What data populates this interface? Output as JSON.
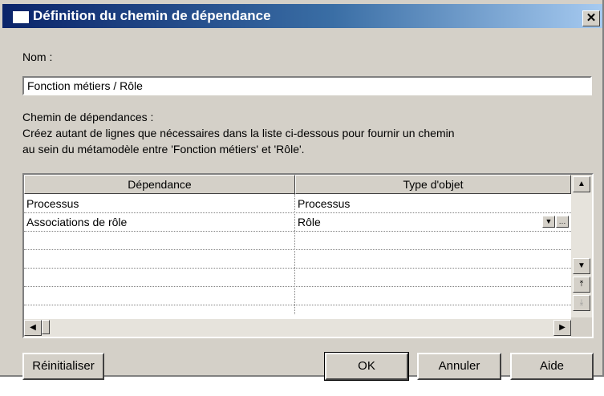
{
  "window": {
    "title": "Définition du chemin de dépendance",
    "close_glyph": "✕"
  },
  "form": {
    "nom_label": "Nom :",
    "nom_value": "Fonction métiers / Rôle",
    "chemin_label": "Chemin de dépendances :",
    "description_line1": "Créez autant de lignes que nécessaires dans la liste ci-dessous pour fournir un chemin",
    "description_line2": "au sein du métamodèle entre 'Fonction métiers' et 'Rôle'."
  },
  "grid": {
    "columns": [
      "Dépendance",
      "Type d'objet"
    ],
    "rows": [
      {
        "dependance": "Processus",
        "type": "Processus"
      },
      {
        "dependance": "Associations de rôle",
        "type": "Rôle"
      },
      {
        "dependance": "",
        "type": ""
      },
      {
        "dependance": "",
        "type": ""
      },
      {
        "dependance": "",
        "type": ""
      },
      {
        "dependance": "",
        "type": ""
      }
    ],
    "dropdown_glyph": "▼",
    "ellipsis_glyph": "…",
    "scroll_up_glyph": "▲",
    "scroll_down_glyph": "▼",
    "scroll_top_glyph": "⤒",
    "scroll_bottom_glyph": "⤓",
    "scroll_left_glyph": "◀",
    "scroll_right_glyph": "▶"
  },
  "buttons": {
    "reset": "Réinitialiser",
    "ok": "OK",
    "cancel": "Annuler",
    "help": "Aide"
  }
}
